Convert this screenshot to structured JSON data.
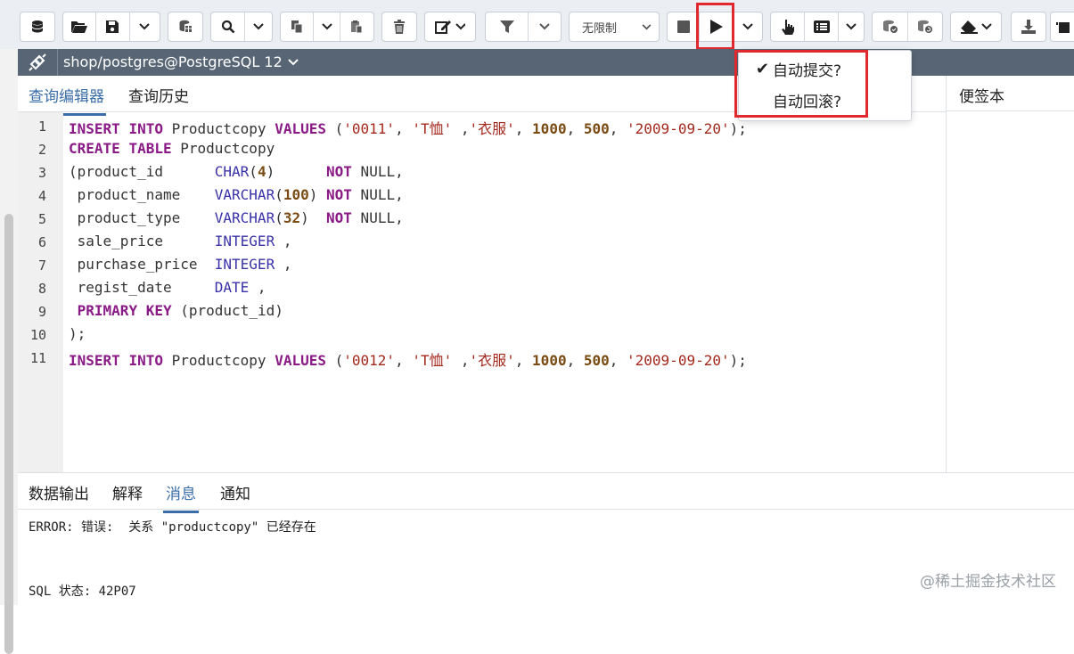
{
  "toolbar": {
    "limit_label": "无限制"
  },
  "connection": {
    "label": "shop/postgres@PostgreSQL 12"
  },
  "editor_tabs": {
    "query_editor": "查询编辑器",
    "query_history": "查询历史"
  },
  "scratch_pad": {
    "title": "便签本"
  },
  "code_lines": [
    {
      "n": "1",
      "parts": [
        [
          "kw",
          "INSERT"
        ],
        [
          "t",
          " "
        ],
        [
          "kw",
          "INTO"
        ],
        [
          "t",
          " Productcopy "
        ],
        [
          "kw",
          "VALUES"
        ],
        [
          "t",
          " ("
        ],
        [
          "st",
          "'0011'"
        ],
        [
          "t",
          ", "
        ],
        [
          "st",
          "'T恤'"
        ],
        [
          "t",
          " ,"
        ],
        [
          "st",
          "'衣服'"
        ],
        [
          "t",
          ", "
        ],
        [
          "nu",
          "1000"
        ],
        [
          "t",
          ", "
        ],
        [
          "nu",
          "500"
        ],
        [
          "t",
          ", "
        ],
        [
          "st",
          "'2009-09-20'"
        ],
        [
          "t",
          ");"
        ]
      ]
    },
    {
      "n": "2",
      "parts": [
        [
          "kw",
          "CREATE"
        ],
        [
          "t",
          " "
        ],
        [
          "kw",
          "TABLE"
        ],
        [
          "t",
          " Productcopy"
        ]
      ]
    },
    {
      "n": "3",
      "parts": [
        [
          "t",
          "(product_id      "
        ],
        [
          "ty",
          "CHAR"
        ],
        [
          "t",
          "("
        ],
        [
          "nu",
          "4"
        ],
        [
          "t",
          ")      "
        ],
        [
          "kw",
          "NOT"
        ],
        [
          "t",
          " NULL,"
        ]
      ]
    },
    {
      "n": "4",
      "parts": [
        [
          "t",
          " product_name    "
        ],
        [
          "ty",
          "VARCHAR"
        ],
        [
          "t",
          "("
        ],
        [
          "nu",
          "100"
        ],
        [
          "t",
          ") "
        ],
        [
          "kw",
          "NOT"
        ],
        [
          "t",
          " NULL,"
        ]
      ]
    },
    {
      "n": "5",
      "parts": [
        [
          "t",
          " product_type    "
        ],
        [
          "ty",
          "VARCHAR"
        ],
        [
          "t",
          "("
        ],
        [
          "nu",
          "32"
        ],
        [
          "t",
          ")  "
        ],
        [
          "kw",
          "NOT"
        ],
        [
          "t",
          " NULL,"
        ]
      ]
    },
    {
      "n": "6",
      "parts": [
        [
          "t",
          " sale_price      "
        ],
        [
          "ty",
          "INTEGER"
        ],
        [
          "t",
          " ,"
        ]
      ]
    },
    {
      "n": "7",
      "parts": [
        [
          "t",
          " purchase_price  "
        ],
        [
          "ty",
          "INTEGER"
        ],
        [
          "t",
          " ,"
        ]
      ]
    },
    {
      "n": "8",
      "parts": [
        [
          "t",
          " regist_date     "
        ],
        [
          "ty",
          "DATE"
        ],
        [
          "t",
          " ,"
        ]
      ]
    },
    {
      "n": "9",
      "parts": [
        [
          "t",
          " "
        ],
        [
          "kw",
          "PRIMARY"
        ],
        [
          "t",
          " "
        ],
        [
          "kw",
          "KEY"
        ],
        [
          "t",
          " (product_id)"
        ]
      ]
    },
    {
      "n": "10",
      "parts": [
        [
          "t",
          ");"
        ]
      ]
    },
    {
      "n": "11",
      "parts": [
        [
          "kw",
          "INSERT"
        ],
        [
          "t",
          " "
        ],
        [
          "kw",
          "INTO"
        ],
        [
          "t",
          " Productcopy "
        ],
        [
          "kw",
          "VALUES"
        ],
        [
          "t",
          " ("
        ],
        [
          "st",
          "'0012'"
        ],
        [
          "t",
          ", "
        ],
        [
          "st",
          "'T恤'"
        ],
        [
          "t",
          " ,"
        ],
        [
          "st",
          "'衣服'"
        ],
        [
          "t",
          ", "
        ],
        [
          "nu",
          "1000"
        ],
        [
          "t",
          ", "
        ],
        [
          "nu",
          "500"
        ],
        [
          "t",
          ", "
        ],
        [
          "st",
          "'2009-09-20'"
        ],
        [
          "t",
          ");"
        ]
      ]
    }
  ],
  "output_tabs": {
    "data_output": "数据输出",
    "explain": "解释",
    "messages": "消息",
    "notifications": "通知"
  },
  "messages": {
    "error_line": "ERROR: 错误:  关系 \"productcopy\" 已经存在",
    "sql_state": "SQL 状态: 42P07"
  },
  "dropdown": {
    "auto_commit": "自动提交?",
    "auto_commit_checked": "✔",
    "auto_rollback": "自动回滚?"
  },
  "watermark": "@稀土掘金技术社区",
  "colors": {
    "connection_bar": "#576575",
    "active_tab": "#3b6ea8",
    "highlight_box": "#e0282e"
  }
}
